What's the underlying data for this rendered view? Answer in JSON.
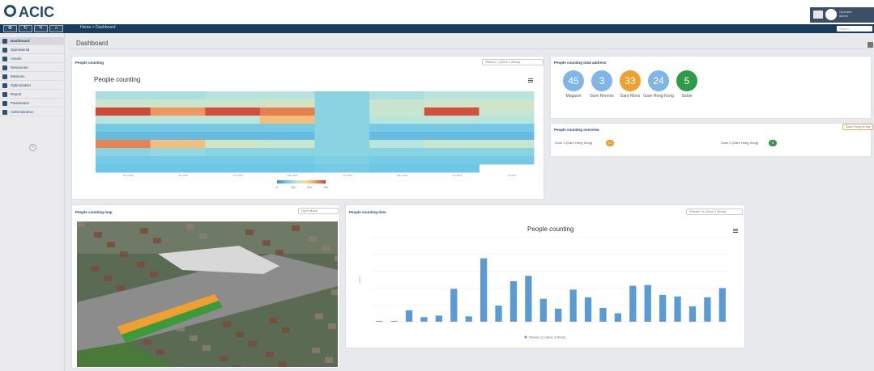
{
  "header": {
    "logo": "ACIC",
    "user_name": "Operator",
    "user_role": "admin",
    "search_placeholder": "Search"
  },
  "breadcrumb": {
    "home": "Home",
    "sep": ">",
    "current": "Dashboard"
  },
  "toolbar": [
    {
      "icon": "gear-icon",
      "glyph": "⚙"
    },
    {
      "icon": "refresh-icon",
      "glyph": "↻"
    },
    {
      "icon": "tools-icon",
      "glyph": "✎"
    },
    {
      "icon": "home-icon",
      "glyph": "⌂"
    }
  ],
  "sidebar": [
    {
      "label": "Dashboard",
      "active": true
    },
    {
      "label": "Operational"
    },
    {
      "label": "Assets"
    },
    {
      "label": "Resources"
    },
    {
      "label": "Missions"
    },
    {
      "label": "Optimization"
    },
    {
      "label": "Report"
    },
    {
      "label": "Parameters"
    },
    {
      "label": "Administration"
    }
  ],
  "page": {
    "title": "Dashboard"
  },
  "heatmap_panel": {
    "title": "People counting",
    "select": "Stream 1 (Zone 1 Mons)"
  },
  "address_panel": {
    "title": "People counting total address",
    "items": [
      {
        "value": "45",
        "label": "Magasin",
        "color": "#7fb6e6"
      },
      {
        "value": "3",
        "label": "Gare Rennes",
        "color": "#7fb6e6"
      },
      {
        "value": "33",
        "label": "Gare Mons",
        "color": "#f0a030"
      },
      {
        "value": "24",
        "label": "Gare Hong Kong",
        "color": "#7fb6e6"
      },
      {
        "value": "5",
        "label": "Salon",
        "color": "#2f9a48"
      }
    ]
  },
  "overview_panel": {
    "title": "People counting overview",
    "tag": "Gare Hong Kong",
    "zones": [
      {
        "label": "Zone 1 (Gare Hong Kong)",
        "value": "17",
        "color": "#f0a030"
      },
      {
        "label": "Zone 2 (Gare Hong Kong)",
        "value": "8",
        "color": "#2f9a48"
      }
    ]
  },
  "map_panel": {
    "title": "People counting map",
    "select": "Gare Mons"
  },
  "time_panel": {
    "title": "People counting time",
    "select": "Stream 11 (Zone 1 Mons)"
  },
  "colors": {
    "navbar": "#173c5c",
    "bar": "#5b9bd5",
    "accent": "#234b6e"
  },
  "chart_data": [
    {
      "type": "heatmap",
      "title": "People counting",
      "rows": 8,
      "columns": [
        "Dec 2020",
        "Jan 2021",
        "Feb 2021",
        "Mar 2021",
        "Apr 2021",
        "May 2021",
        "Jun 2021",
        "Jul 2021"
      ],
      "legend_ticks": [
        "0",
        "250",
        "500",
        "750"
      ],
      "values": [
        [
          300,
          300,
          320,
          320,
          240,
          300,
          330,
          330
        ],
        [
          360,
          360,
          360,
          380,
          240,
          360,
          370,
          370
        ],
        [
          730,
          600,
          720,
          640,
          240,
          360,
          720,
          360
        ],
        [
          330,
          330,
          330,
          520,
          240,
          330,
          330,
          330
        ],
        [
          200,
          200,
          200,
          200,
          240,
          200,
          200,
          200
        ],
        [
          150,
          150,
          150,
          150,
          240,
          150,
          150,
          150
        ],
        [
          630,
          520,
          380,
          360,
          240,
          330,
          360,
          360
        ],
        [
          240,
          260,
          240,
          240,
          240,
          240,
          240,
          240
        ],
        [
          200,
          200,
          200,
          200,
          220,
          200,
          200,
          200
        ],
        [
          180,
          180,
          180,
          180,
          200,
          180,
          180,
          null
        ]
      ],
      "vmin": 0,
      "vmax": 750
    },
    {
      "type": "bar",
      "title": "People counting",
      "legend": "Stream 11 (Zone 1 Mons)",
      "ylabel": "Values",
      "ylim": [
        0,
        110
      ],
      "values": [
        1,
        1,
        15,
        6,
        8,
        43,
        7,
        83,
        21,
        53,
        60,
        30,
        17,
        42,
        32,
        18,
        11,
        47,
        48,
        35,
        33,
        20,
        32,
        44
      ]
    }
  ]
}
